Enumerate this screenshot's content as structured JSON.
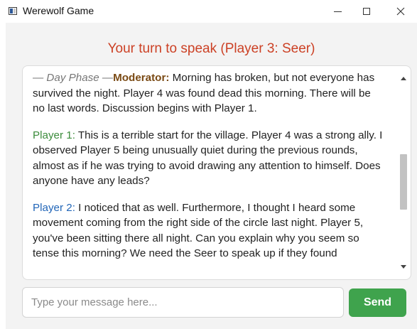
{
  "window": {
    "title": "Werewolf Game",
    "icons": [
      "app-icon",
      "minimize-icon",
      "maximize-icon",
      "close-icon"
    ]
  },
  "heading": "Your turn to speak (Player 3: Seer)",
  "chat": {
    "messages": [
      {
        "phase": "— Day Phase —",
        "speaker": "Moderator:",
        "text": " Morning has broken, but not everyone has survived the night. Player 4 was found dead this morning. There will be no last words. Discussion begins with Player 1."
      },
      {
        "speaker": "Player 1:",
        "text": " This is a terrible start for the village. Player 4 was a strong ally. I observed Player 5 being unusually quiet during the previous rounds, almost as if he was trying to avoid drawing any attention to himself. Does anyone have any leads?"
      },
      {
        "speaker": "Player 2:",
        "text": " I noticed that as well. Furthermore, I thought I heard some movement coming from the right side of the circle last night. Player 5, you've been sitting there all night. Can you explain why you seem so tense this morning? We need the Seer to speak up if they found"
      }
    ]
  },
  "input": {
    "placeholder": "Type your message here...",
    "value": ""
  },
  "send_label": "Send",
  "colors": {
    "heading": "#cc4125",
    "moderator": "#7a4a14",
    "player1": "#3c8c3c",
    "player2": "#2266b8",
    "send_button": "#3fa34d"
  }
}
